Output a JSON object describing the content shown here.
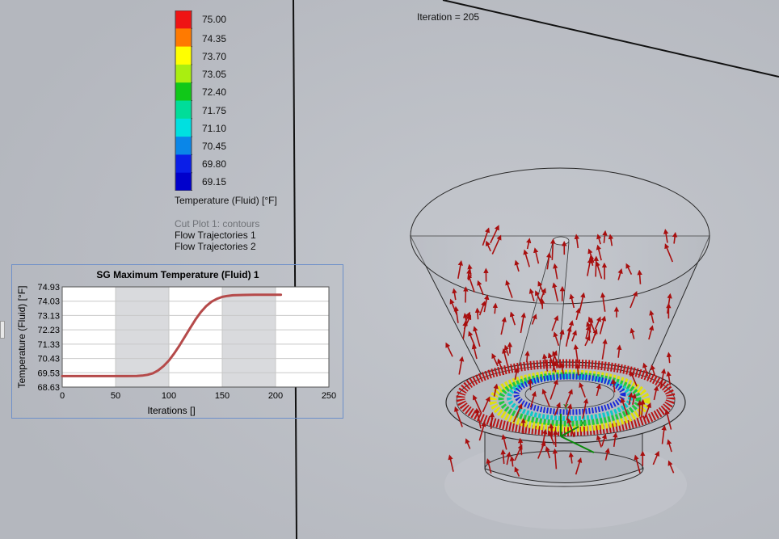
{
  "iteration_label": "Iteration = 205",
  "legend": {
    "title": "Temperature (Fluid) [°F]",
    "values": [
      "75.00",
      "74.35",
      "73.70",
      "73.05",
      "72.40",
      "71.75",
      "71.10",
      "70.45",
      "69.80",
      "69.15"
    ],
    "colors": [
      "#ef1414",
      "#ff7a00",
      "#ffff00",
      "#aaee10",
      "#10c818",
      "#00dd99",
      "#00e0e0",
      "#0a86e8",
      "#0a1ee8",
      "#0000cc"
    ]
  },
  "features": {
    "cut_plot": "Cut Plot 1: contours",
    "flow_traj_1": "Flow Trajectories 1",
    "flow_traj_2": "Flow Trajectories 2"
  },
  "chart_data": {
    "type": "line",
    "title": "SG Maximum Temperature (Fluid) 1",
    "xlabel": "Iterations []",
    "ylabel": "Temperature (Fluid) [°F]",
    "xlim": [
      0,
      250
    ],
    "ylim": [
      68.63,
      74.93
    ],
    "xticks": [
      0,
      50,
      100,
      150,
      200,
      250
    ],
    "yticks": [
      "74.93",
      "74.03",
      "73.13",
      "72.23",
      "71.33",
      "70.43",
      "69.53",
      "68.63"
    ],
    "grid": true,
    "shaded_ranges": [
      [
        50,
        100
      ],
      [
        150,
        200
      ]
    ],
    "series": [
      {
        "color": "#b54a4a",
        "x": [
          0,
          20,
          40,
          60,
          70,
          75,
          80,
          85,
          90,
          95,
          100,
          105,
          110,
          115,
          120,
          125,
          130,
          135,
          140,
          145,
          150,
          155,
          160,
          170,
          180,
          190,
          200,
          205
        ],
        "y": [
          69.32,
          69.32,
          69.32,
          69.32,
          69.33,
          69.35,
          69.4,
          69.5,
          69.68,
          69.95,
          70.3,
          70.75,
          71.25,
          71.8,
          72.35,
          72.88,
          73.35,
          73.72,
          74.0,
          74.18,
          74.3,
          74.36,
          74.4,
          74.42,
          74.43,
          74.43,
          74.43,
          74.43
        ]
      }
    ]
  }
}
